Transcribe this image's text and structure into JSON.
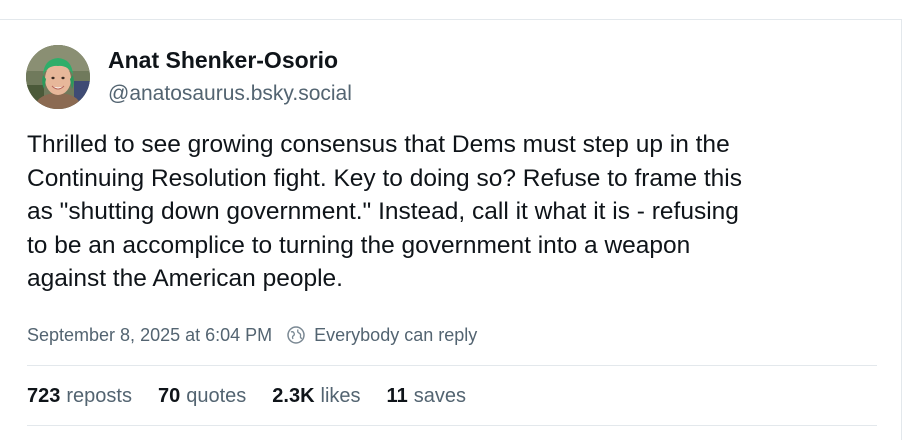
{
  "author": {
    "display_name": "Anat Shenker-Osorio",
    "handle": "@anatosaurus.bsky.social",
    "avatar_icon": "profile-photo"
  },
  "post": {
    "text": "Thrilled to see growing consensus that Dems must step up in the\nContinuing Resolution fight. Key to doing so? Refuse to frame this\nas \"shutting down government.\" Instead, call it what it is - refusing\nto be an accomplice to turning the government into a weapon\nagainst the American people.",
    "timestamp": "September 8, 2025 at 6:04 PM",
    "reply_setting": "Everybody can reply",
    "reply_setting_icon": "globe-icon"
  },
  "stats": {
    "reposts": {
      "count": "723",
      "label": "reposts"
    },
    "quotes": {
      "count": "70",
      "label": "quotes"
    },
    "likes": {
      "count": "2.3K",
      "label": "likes"
    },
    "saves": {
      "count": "11",
      "label": "saves"
    }
  },
  "colors": {
    "text_primary": "#0f1419",
    "text_secondary": "#536471",
    "divider": "#e3e8ec",
    "avatar_hair": "#2fae6a"
  }
}
